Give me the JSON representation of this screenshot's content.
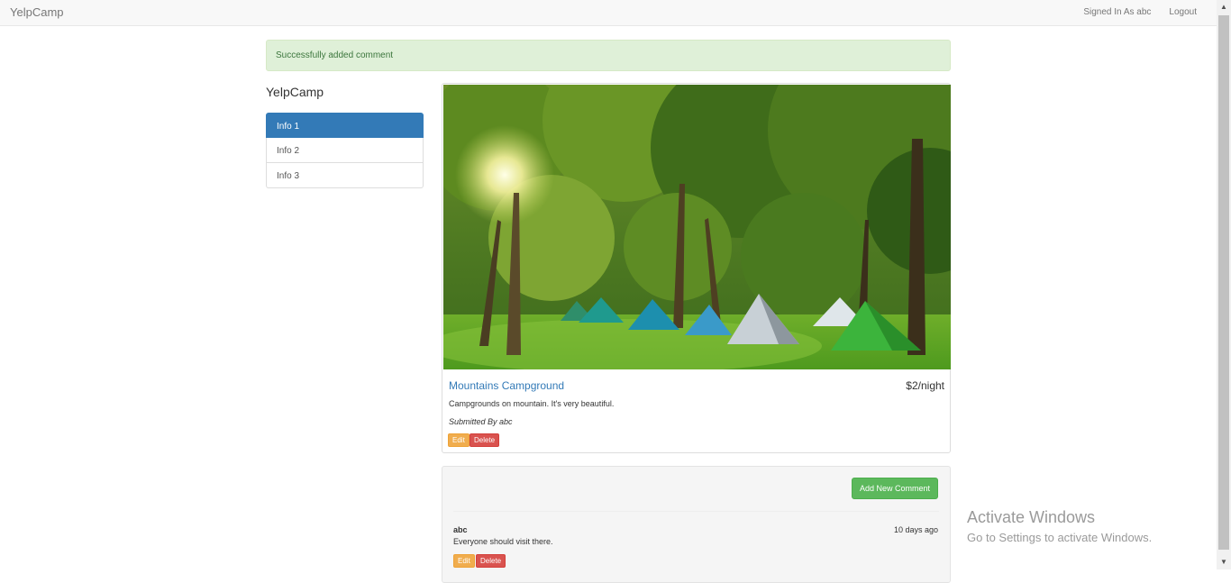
{
  "navbar": {
    "brand": "YelpCamp",
    "signed_in": "Signed In As abc",
    "logout": "Logout"
  },
  "flash": {
    "message": "Successfully added comment"
  },
  "sidebar": {
    "title": "YelpCamp",
    "items": [
      {
        "label": "Info 1",
        "active": true
      },
      {
        "label": "Info 2",
        "active": false
      },
      {
        "label": "Info 3",
        "active": false
      }
    ]
  },
  "campground": {
    "name": "Mountains Campground",
    "price": "$2/night",
    "description": "Campgrounds on mountain. It's very beautiful.",
    "submitted_by": "Submitted By abc",
    "edit_label": "Edit",
    "delete_label": "Delete"
  },
  "comments": {
    "add_label": "Add New Comment",
    "items": [
      {
        "author": "abc",
        "time": "10 days ago",
        "text": "Everyone should visit there.",
        "edit_label": "Edit",
        "delete_label": "Delete"
      }
    ]
  },
  "watermark": {
    "title": "Activate Windows",
    "subtitle": "Go to Settings to activate Windows."
  },
  "colors": {
    "primary": "#337ab7",
    "success": "#5cb85c",
    "warning": "#f0ad4e",
    "danger": "#d9534f",
    "alert_bg": "#dff0d8"
  }
}
